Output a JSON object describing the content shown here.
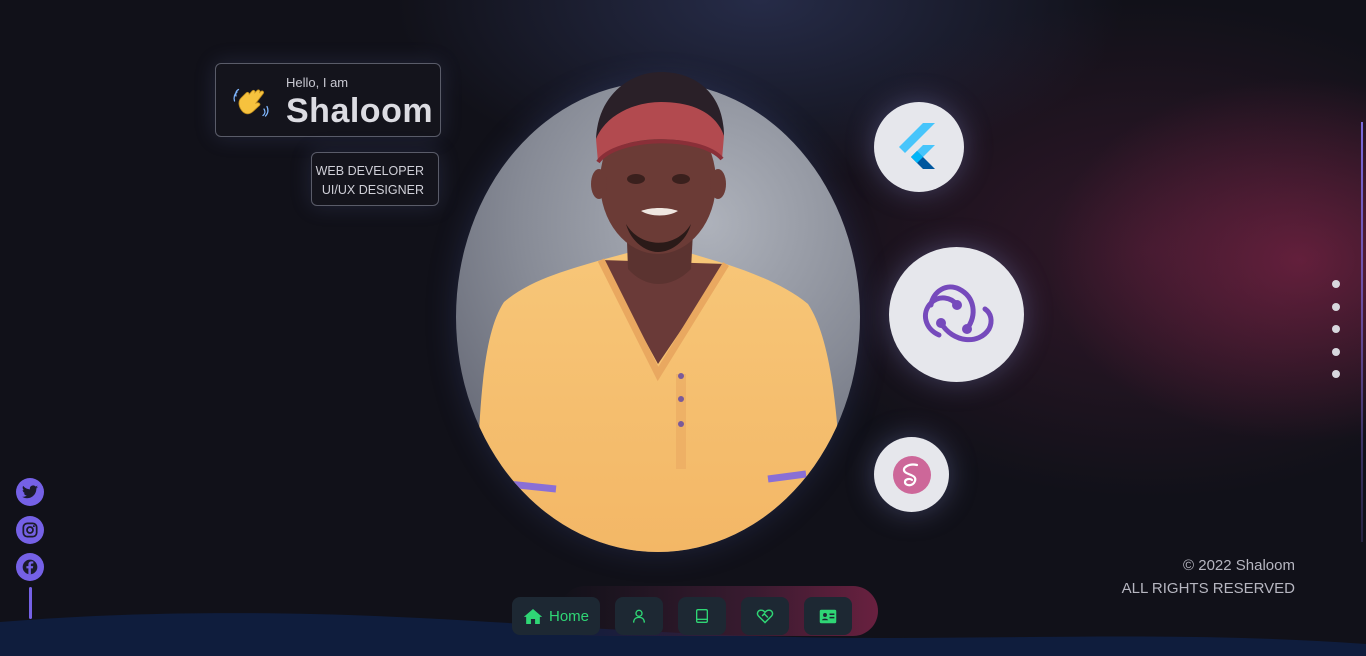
{
  "hero": {
    "greeting": "Hello, I am",
    "name": "Shaloom",
    "emoji_icon": "waving-hand-icon",
    "roles": [
      "WEB DEVELOPER",
      "UI/UX DESIGNER"
    ]
  },
  "tech_icons": [
    "flutter-icon",
    "redux-icon",
    "sass-icon"
  ],
  "social": {
    "items": [
      "twitter-icon",
      "instagram-icon",
      "facebook-icon"
    ],
    "color": "#7561e6"
  },
  "footer": {
    "copyright": "© 2022 Shaloom",
    "rights": "ALL RIGHTS RESERVED"
  },
  "nav": {
    "home_label": "Home",
    "items": [
      "home-icon",
      "user-icon",
      "book-icon",
      "heart-handshake-icon",
      "contact-card-icon"
    ],
    "accent": "#2fd675"
  },
  "section_dots": 5
}
